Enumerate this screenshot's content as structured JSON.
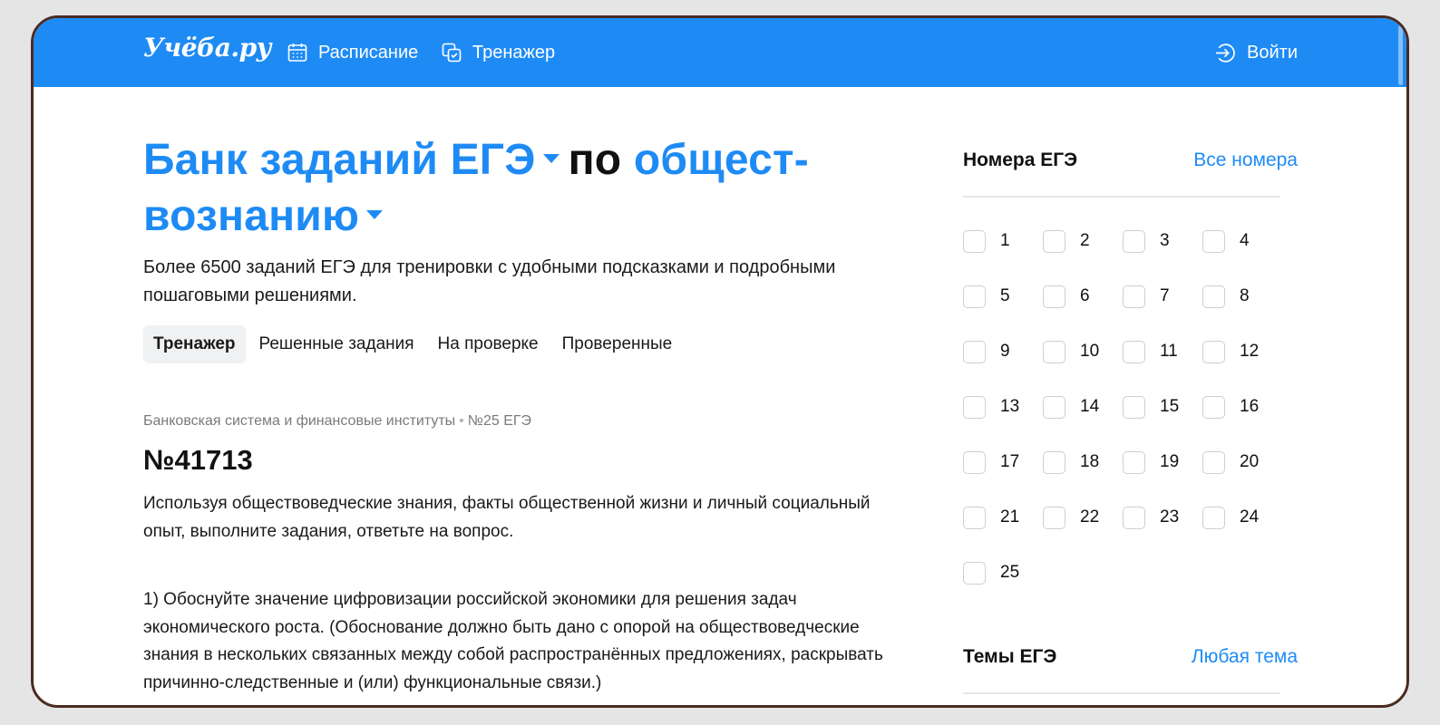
{
  "header": {
    "logo": "Учёба.ру",
    "nav": [
      {
        "label": "Расписание",
        "icon": "calendar-icon"
      },
      {
        "label": "Тренажер",
        "icon": "copy-icon"
      }
    ],
    "login": {
      "label": "Войти",
      "icon": "login-icon"
    },
    "accent_color": "#1e8bf5"
  },
  "main": {
    "title": {
      "part1": "Банк заданий ЕГЭ",
      "part2": "по",
      "part3": "общест-вознанию"
    },
    "subtitle": "Более 6500 заданий ЕГЭ для тренировки с удобными подсказками и подробными пошаговыми решениями.",
    "tabs": [
      {
        "label": "Тренажер",
        "active": true
      },
      {
        "label": "Решенные задания",
        "active": false
      },
      {
        "label": "На проверке",
        "active": false
      },
      {
        "label": "Проверенные",
        "active": false
      }
    ],
    "task": {
      "topic": "Банковская система и финансовые институты",
      "separator": "•",
      "number_ref": "№25 ЕГЭ",
      "id": "№41713",
      "intro": "Используя обществоведческие знания, факты общественной жизни и личный социальный опыт, выполните задания, ответьте на вопрос.",
      "question": "1) Обоснуйте значение цифровизации российской экономики для решения задач экономического роста. (Обоснование должно быть дано с опорой на обществоведческие знания в нескольких связанных между собой распространённых предложениях, раскрывать причинно-следственные и (или) функциональные связи.)"
    }
  },
  "sidebar": {
    "numbers_title": "Номера ЕГЭ",
    "numbers_link": "Все номера",
    "numbers": [
      "1",
      "2",
      "3",
      "4",
      "5",
      "6",
      "7",
      "8",
      "9",
      "10",
      "11",
      "12",
      "13",
      "14",
      "15",
      "16",
      "17",
      "18",
      "19",
      "20",
      "21",
      "22",
      "23",
      "24",
      "25"
    ],
    "topics_title": "Темы ЕГЭ",
    "topics_link": "Любая тема"
  }
}
